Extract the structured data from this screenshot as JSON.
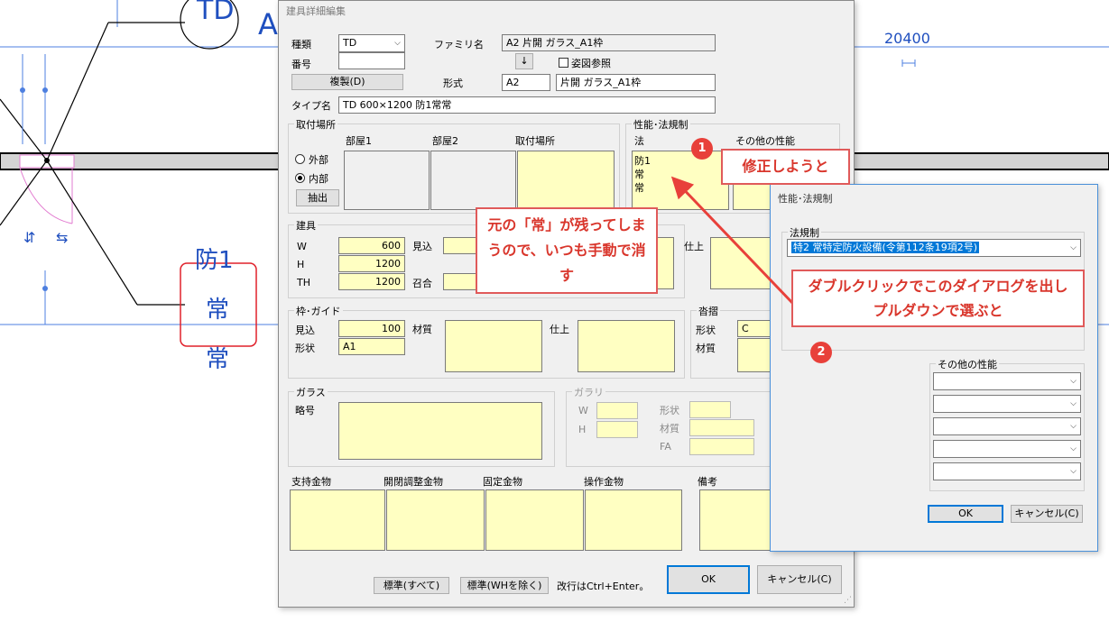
{
  "cad": {
    "label_td": "TD",
    "label_a": "A",
    "dimension": "20400",
    "tag_line1": "防1",
    "tag_line2": "常",
    "tag_line3": "常"
  },
  "main": {
    "title": "建具詳細編集",
    "kind_label": "種類",
    "kind_value": "TD",
    "number_label": "番号",
    "number_value": "",
    "copy_button": "複製(D)",
    "family_label": "ファミリ名",
    "family_value": "A2 片開 ガラス_A1枠",
    "arrow_button": "↓",
    "elevation_check": "姿図参照",
    "form_label": "形式",
    "form_code": "A2",
    "form_name": "片開 ガラス_A1枠",
    "type_label": "タイプ名",
    "type_value": "TD 600×1200 防1常常",
    "mount": {
      "group": "取付場所",
      "col_room1": "部屋1",
      "col_room2": "部屋2",
      "col_place": "取付場所",
      "radio_outside": "外部",
      "radio_inside": "内部",
      "extract_button": "抽出"
    },
    "perf": {
      "group": "性能･法規制",
      "law_label": "法",
      "other_label": "その他の性能",
      "law_lines": [
        "防1",
        "常",
        "常"
      ]
    },
    "fitting": {
      "group": "建具",
      "w_label": "W",
      "w_value": "600",
      "h_label": "H",
      "h_value": "1200",
      "th_label": "TH",
      "th_value": "1200",
      "mikomi_label": "見込",
      "kaigo_label": "召合",
      "finish_label": "仕上"
    },
    "frame": {
      "group": "枠･ガイド",
      "mikomi_label": "見込",
      "mikomi_value": "100",
      "shape_label": "形状",
      "shape_value": "A1",
      "material_label": "材質",
      "finish_label": "仕上"
    },
    "back": {
      "group": "沓摺",
      "shape_label": "形状",
      "shape_value": "C",
      "material_label": "材質"
    },
    "glass": {
      "group": "ガラス",
      "code_label": "略号"
    },
    "garari": {
      "group": "ガラリ",
      "w_label": "W",
      "h_label": "H",
      "shape_label": "形状",
      "material_label": "材質",
      "fa_label": "FA"
    },
    "hardware": {
      "support": "支持金物",
      "adjust": "開閉調整金物",
      "fixed": "固定金物",
      "operate": "操作金物",
      "notes": "備考"
    },
    "std_all_button": "標準(すべて)",
    "std_ex_wh_button": "標準(WHを除く)",
    "newline_hint": "改行はCtrl+Enter。",
    "ok_button": "OK",
    "cancel_button": "キャンセル(C)"
  },
  "sub": {
    "title": "性能･法規制",
    "law_group": "法規制",
    "law_selected": "特2 常特定防火設備(令第112条19項2号)",
    "other_group": "その他の性能",
    "other_selects": [
      "",
      "",
      "",
      "",
      ""
    ],
    "ok_button": "OK",
    "cancel_button": "キャンセル(C)"
  },
  "annotations": {
    "badge1": "1",
    "badge2": "2",
    "callout_fix": "修正しようと",
    "callout_remain": "元の「常」が残ってしまうので、いつも手動で消す",
    "callout_dbl": "ダブルクリックでこのダイアログを出しプルダウンで選ぶと"
  },
  "colors": {
    "callout_border": "#e05a5a",
    "callout_text": "#d9362c",
    "badge": "#e8403a",
    "field_yellow": "#ffffc2",
    "cad_blue": "#1f4fbf",
    "highlight_red": "#e0202a"
  }
}
